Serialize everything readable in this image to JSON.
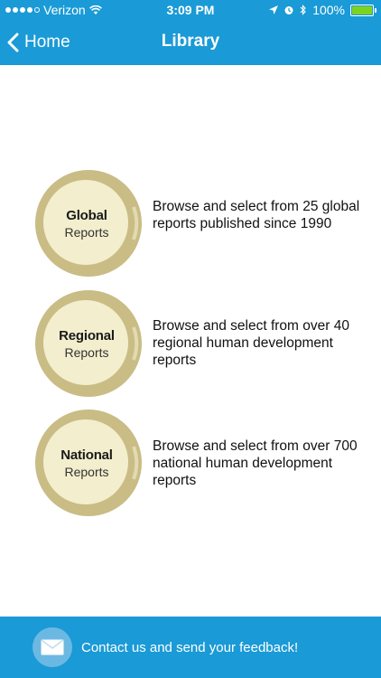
{
  "status_bar": {
    "carrier": "Verizon",
    "time": "3:09 PM",
    "battery_percent": "100%",
    "signal_bars": 4,
    "battery_color": "#7ed321"
  },
  "nav": {
    "back_label": "Home",
    "title": "Library"
  },
  "reports": [
    {
      "title": "Global",
      "subtitle": "Reports",
      "description": "Browse and select from 25 global reports published since 1990"
    },
    {
      "title": "Regional",
      "subtitle": "Reports",
      "description": "Browse and select from over 40 regional human development reports"
    },
    {
      "title": "National",
      "subtitle": "Reports",
      "description": "Browse and select from over 700 national human development reports"
    }
  ],
  "footer": {
    "label": "Contact us and send your feedback!",
    "icon": "mail-icon"
  },
  "colors": {
    "header_blue": "#1a9ad6",
    "circle_ring": "#c9bc85",
    "circle_fill": "#f3eecd"
  }
}
